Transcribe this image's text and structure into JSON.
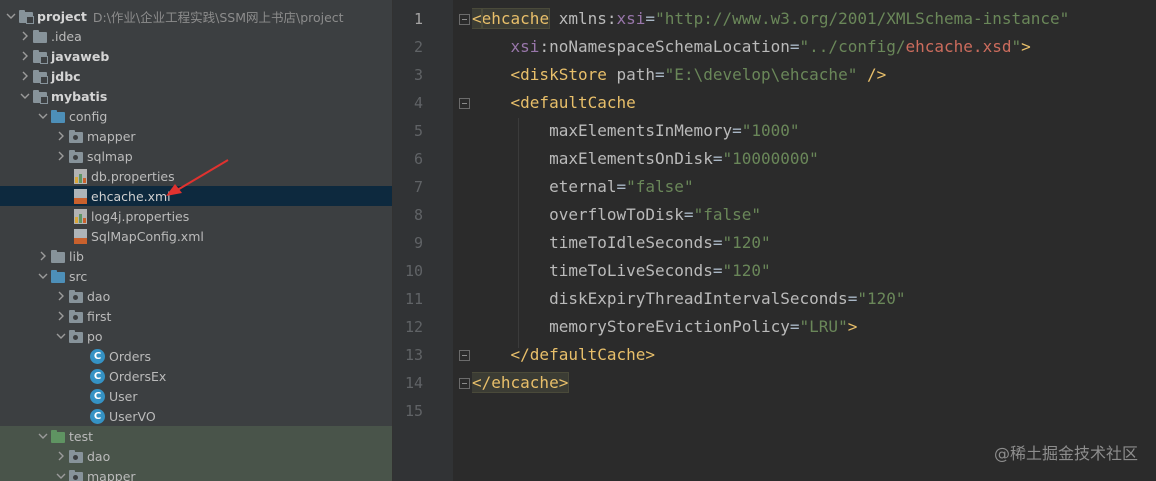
{
  "tree": {
    "rows": [
      {
        "label": "project",
        "extra": "D:\\作业\\企业工程实践\\SSM网上书店\\project"
      },
      {
        "label": ".idea"
      },
      {
        "label": "javaweb"
      },
      {
        "label": "jdbc"
      },
      {
        "label": "mybatis"
      },
      {
        "label": "config"
      },
      {
        "label": "mapper"
      },
      {
        "label": "sqlmap"
      },
      {
        "label": "db.properties"
      },
      {
        "label": "ehcache.xml"
      },
      {
        "label": "log4j.properties"
      },
      {
        "label": "SqlMapConfig.xml"
      },
      {
        "label": "lib"
      },
      {
        "label": "src"
      },
      {
        "label": "dao"
      },
      {
        "label": "first"
      },
      {
        "label": "po"
      },
      {
        "label": "Orders"
      },
      {
        "label": "OrdersEx"
      },
      {
        "label": "User"
      },
      {
        "label": "UserVO"
      },
      {
        "label": "test"
      },
      {
        "label": "dao"
      },
      {
        "label": "mapper"
      }
    ],
    "class_icon_letter": "C",
    "arrow_color": "#e0322f"
  },
  "editor": {
    "line_numbers": [
      "1",
      "2",
      "3",
      "4",
      "5",
      "6",
      "7",
      "8",
      "9",
      "10",
      "11",
      "12",
      "13",
      "14",
      "15"
    ],
    "lines": [
      [
        [
          "tag-hl",
          "<"
        ],
        [
          "tag-hl",
          "ehcache"
        ],
        [
          "punct",
          " "
        ],
        [
          "attr",
          "xmlns:"
        ],
        [
          "attr-ns",
          "xsi"
        ],
        [
          "punct",
          "="
        ],
        [
          "str",
          "\"http://www.w3.org/2001/XMLSchema-instance\""
        ]
      ],
      [
        [
          "punct",
          "    "
        ],
        [
          "attr-ns",
          "xsi"
        ],
        [
          "attr",
          ":noNamespaceSchemaLocation"
        ],
        [
          "punct",
          "="
        ],
        [
          "str",
          "\"../config/"
        ],
        [
          "str-red",
          "ehcache.xsd"
        ],
        [
          "str",
          "\""
        ],
        [
          "tag",
          ">"
        ]
      ],
      [
        [
          "punct",
          "    "
        ],
        [
          "tag",
          "<diskStore"
        ],
        [
          "punct",
          " "
        ],
        [
          "attr",
          "path"
        ],
        [
          "punct",
          "="
        ],
        [
          "str",
          "\"E:\\develop\\ehcache\""
        ],
        [
          "punct",
          " "
        ],
        [
          "tag",
          "/>"
        ]
      ],
      [
        [
          "punct",
          "    "
        ],
        [
          "tag",
          "<defaultCache"
        ]
      ],
      [
        [
          "punct",
          "        "
        ],
        [
          "attr",
          "maxElementsInMemory"
        ],
        [
          "punct",
          "="
        ],
        [
          "str",
          "\"1000\""
        ]
      ],
      [
        [
          "punct",
          "        "
        ],
        [
          "attr",
          "maxElementsOnDisk"
        ],
        [
          "punct",
          "="
        ],
        [
          "str",
          "\"10000000\""
        ]
      ],
      [
        [
          "punct",
          "        "
        ],
        [
          "attr",
          "eternal"
        ],
        [
          "punct",
          "="
        ],
        [
          "str",
          "\"false\""
        ]
      ],
      [
        [
          "punct",
          "        "
        ],
        [
          "attr",
          "overflowToDisk"
        ],
        [
          "punct",
          "="
        ],
        [
          "str",
          "\"false\""
        ]
      ],
      [
        [
          "punct",
          "        "
        ],
        [
          "attr",
          "timeToIdleSeconds"
        ],
        [
          "punct",
          "="
        ],
        [
          "str",
          "\"120\""
        ]
      ],
      [
        [
          "punct",
          "        "
        ],
        [
          "attr",
          "timeToLiveSeconds"
        ],
        [
          "punct",
          "="
        ],
        [
          "str",
          "\"120\""
        ]
      ],
      [
        [
          "punct",
          "        "
        ],
        [
          "attr",
          "diskExpiryThreadIntervalSeconds"
        ],
        [
          "punct",
          "="
        ],
        [
          "str",
          "\"120\""
        ]
      ],
      [
        [
          "punct",
          "        "
        ],
        [
          "attr",
          "memoryStoreEvictionPolicy"
        ],
        [
          "punct",
          "="
        ],
        [
          "str",
          "\"LRU\""
        ],
        [
          "tag",
          ">"
        ]
      ],
      [
        [
          "punct",
          "    "
        ],
        [
          "tag",
          "</defaultCache>"
        ]
      ],
      [
        [
          "tag-hl",
          "</ehcache>"
        ]
      ],
      []
    ]
  },
  "watermark": "@稀土掘金技术社区",
  "colors": {
    "tree_bg": "#3c3f41",
    "editor_bg": "#2b2b2b",
    "selection": "#0d293e",
    "test_zone": "#49544a",
    "tag": "#e8bf6a",
    "string": "#6a8759",
    "attribute": "#bababa",
    "namespace": "#9876aa"
  }
}
